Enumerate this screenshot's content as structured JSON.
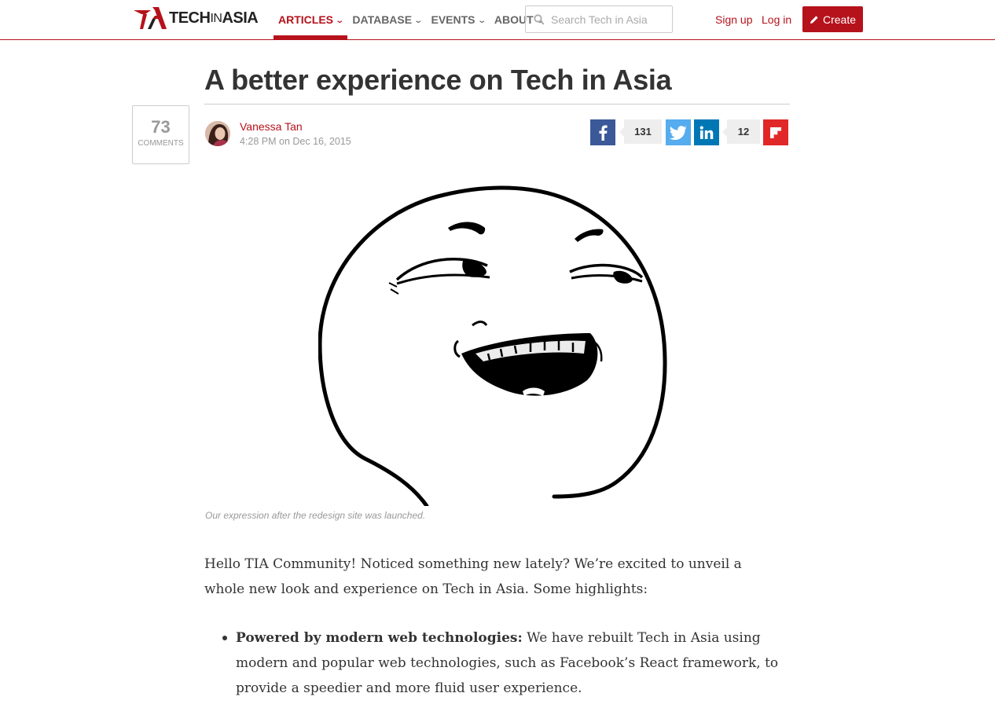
{
  "brand": {
    "logo_part1": "TECH",
    "logo_part2": "IN",
    "logo_part3": "ASIA",
    "accent_color": "#b5121b"
  },
  "nav": {
    "items": [
      {
        "label": "ARTICLES",
        "active": true
      },
      {
        "label": "DATABASE",
        "active": false
      },
      {
        "label": "EVENTS",
        "active": false
      },
      {
        "label": "ABOUT",
        "active": false
      }
    ]
  },
  "search": {
    "placeholder": "Search Tech in Asia",
    "icon": "search-icon"
  },
  "auth": {
    "signup": "Sign up",
    "login": "Log in",
    "create": "Create",
    "create_icon": "pencil-icon"
  },
  "article": {
    "title": "A better experience on Tech in Asia",
    "comments": {
      "count": "73",
      "label": "COMMENTS"
    },
    "author": "Vanessa Tan",
    "date": "4:28 PM on Dec 16, 2015",
    "share": {
      "facebook_icon": "facebook-icon",
      "facebook_count": "131",
      "twitter_icon": "twitter-icon",
      "linkedin_icon": "linkedin-icon",
      "linkedin_count": "12",
      "flipboard_icon": "flipboard-icon"
    },
    "image_caption": "Our expression after the redesign site was launched.",
    "intro": "Hello TIA Community! Noticed something new lately? We’re excited to unveil a whole new look and experience on Tech in Asia. Some highlights:",
    "highlights": [
      {
        "heading": "Powered by modern web technologies:",
        "text": " We have rebuilt Tech in Asia using modern and popular web technologies, such as Facebook’s React framework, to provide a speedier and more fluid user experience."
      }
    ]
  }
}
